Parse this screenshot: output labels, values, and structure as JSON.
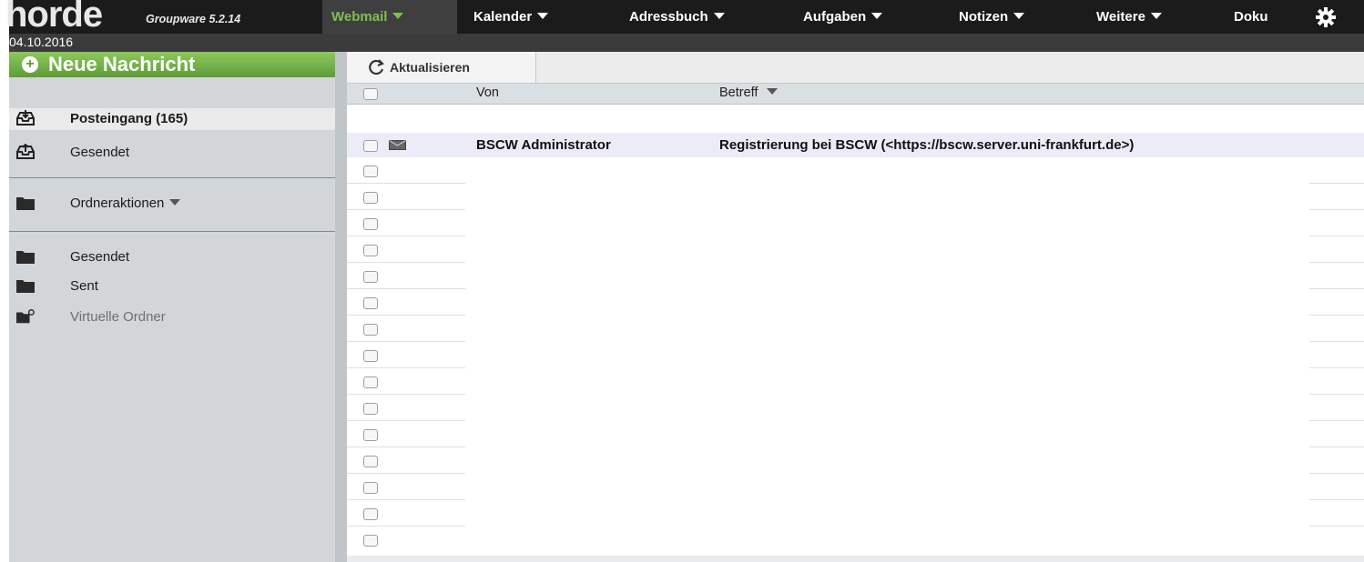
{
  "app": {
    "logo_text": "horde",
    "logo_subtitle": "Groupware 5.2.14",
    "date": "04.10.2016"
  },
  "nav": {
    "items": [
      {
        "label": "Webmail",
        "active": true,
        "has_menu": true
      },
      {
        "label": "Kalender",
        "active": false,
        "has_menu": true
      },
      {
        "label": "Adressbuch",
        "active": false,
        "has_menu": true
      },
      {
        "label": "Aufgaben",
        "active": false,
        "has_menu": true
      },
      {
        "label": "Notizen",
        "active": false,
        "has_menu": true
      },
      {
        "label": "Weitere",
        "active": false,
        "has_menu": true
      },
      {
        "label": "Doku",
        "active": false,
        "has_menu": false
      }
    ],
    "settings_icon": "gear-icon"
  },
  "sidebar": {
    "new_message_label": "Neue Nachricht",
    "folders_top": [
      {
        "label": "Posteingang (165)",
        "icon": "inbox-icon",
        "selected": true
      },
      {
        "label": "Gesendet",
        "icon": "sent-tray-icon",
        "selected": false
      }
    ],
    "folder_actions_label": "Ordneraktionen",
    "folders_bottom": [
      {
        "label": "Gesendet",
        "icon": "folder-icon"
      },
      {
        "label": "Sent",
        "icon": "folder-icon"
      },
      {
        "label": "Virtuelle Ordner",
        "icon": "virtual-folder-icon"
      }
    ]
  },
  "toolbar": {
    "refresh_label": "Aktualisieren"
  },
  "message_list": {
    "columns": {
      "from": "Von",
      "subject": "Betreff"
    },
    "sort_column": "subject",
    "messages": [
      {
        "from": "BSCW Administrator",
        "subject": "Registrierung bei BSCW (<https://bscw.server.uni-frankfurt.de>)",
        "unread": true
      }
    ]
  },
  "colors": {
    "topbar": "#1b1b1b",
    "active_nav_text": "#7cc14f",
    "new_message_green": "#6aa841",
    "sidebar_bg": "#d2d6d9",
    "selected_row_bg": "#ecebf8"
  }
}
